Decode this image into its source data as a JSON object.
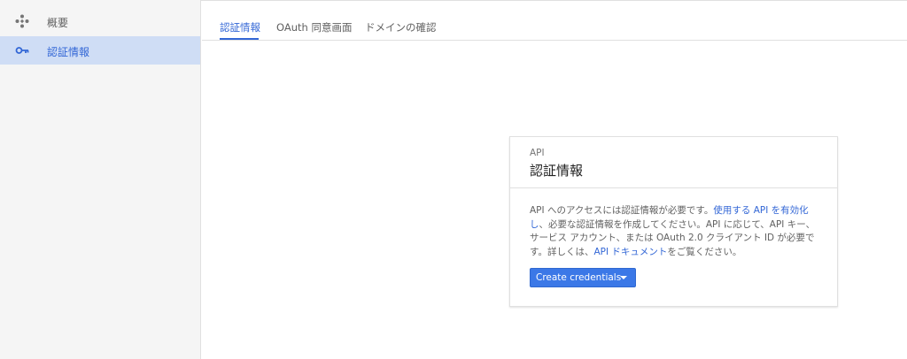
{
  "sidebar": {
    "items": [
      {
        "label": "概要",
        "icon": "overview-icon"
      },
      {
        "label": "認証情報",
        "icon": "key-icon",
        "selected": true
      }
    ]
  },
  "tabs": [
    {
      "label": "認証情報",
      "active": true
    },
    {
      "label": "OAuth 同意画面"
    },
    {
      "label": "ドメインの確認"
    }
  ],
  "card": {
    "subtitle": "API",
    "title": "認証情報",
    "body": {
      "t1": "API へのアクセスには認証情報が必要です。",
      "link1": "使用する API を有効化し",
      "t2": "、必要な認証情報を作成してください。API に応じて、API キー、サービス アカウント、または OAuth 2.0 クライアント ID が必要です。詳しくは、",
      "link2": "API ドキュメント",
      "t3": "をご覧ください。"
    },
    "button_label": "Create credentials"
  },
  "colors": {
    "accent": "#3367d6",
    "button": "#3b78e7",
    "selected_bg": "#cfddf5",
    "sidebar_bg": "#f5f5f5"
  }
}
